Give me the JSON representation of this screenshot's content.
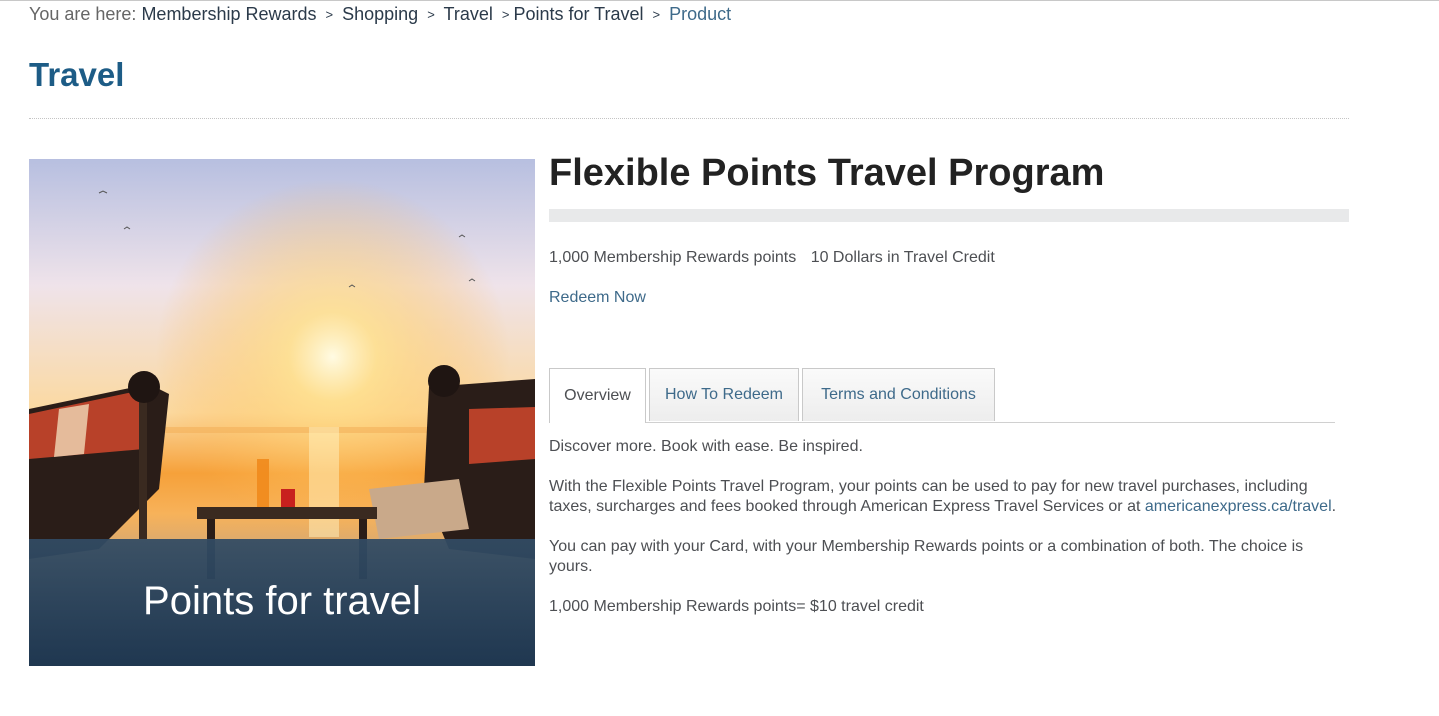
{
  "breadcrumb": {
    "prefix": "You are here:",
    "items": [
      "Membership Rewards",
      "Shopping",
      "Travel",
      "Points for Travel"
    ],
    "current": "Product",
    "separator": ">"
  },
  "page_title": "Travel",
  "hero": {
    "overlay_text": "Points for travel"
  },
  "product": {
    "title": "Flexible Points Travel Program",
    "points": "1,000 Membership Rewards points",
    "value": "10 Dollars in Travel Credit",
    "redeem_label": "Redeem Now"
  },
  "tabs": [
    {
      "label": "Overview",
      "active": true
    },
    {
      "label": "How To Redeem",
      "active": false
    },
    {
      "label": "Terms and Conditions",
      "active": false
    }
  ],
  "overview": {
    "p1": "Discover more. Book with ease. Be inspired.",
    "p2_text": "With the Flexible Points Travel Program, your points can be used to pay for new travel purchases, including taxes, surcharges and fees booked through American Express Travel Services or at",
    "p2_link": "americanexpress.ca/travel",
    "p2_end": ".",
    "p3": "You can pay with your Card, with your Membership Rewards points or a combination of both. The choice is yours.",
    "p4": "1,000 Membership Rewards points= $10 travel credit"
  },
  "colors": {
    "title_blue": "#1d5c86",
    "link_blue": "#3e6a8a",
    "text_grey": "#4d4f53"
  }
}
